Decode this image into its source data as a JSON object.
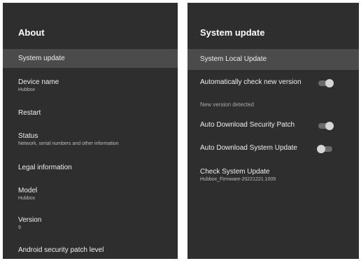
{
  "left": {
    "title": "About",
    "items": [
      {
        "label": "System update",
        "sub": ""
      },
      {
        "label": "Device name",
        "sub": "Hubbox"
      },
      {
        "label": "Restart",
        "sub": ""
      },
      {
        "label": "Status",
        "sub": "Network, serial numbers and other information"
      },
      {
        "label": "Legal information",
        "sub": ""
      },
      {
        "label": "Model",
        "sub": "Hubbox"
      },
      {
        "label": "Version",
        "sub": "9"
      },
      {
        "label": "Android security patch level",
        "sub": ""
      }
    ]
  },
  "right": {
    "title": "System update",
    "selected_item": "System Local Update",
    "auto_check_label": "Automatically check new version",
    "auto_check_on": true,
    "new_version_label": "New version detected",
    "auto_download_security_label": "Auto Download Security Patch",
    "auto_download_security_on": true,
    "auto_download_system_label": "Auto Download System Update",
    "auto_download_system_on": false,
    "check_update_label": "Check System Update",
    "check_update_sub": "Hubbox_Firmware-20221221.1009"
  },
  "colors": {
    "panel_bg": "#2e2e2e",
    "selected_bg": "#4b4b4b"
  }
}
